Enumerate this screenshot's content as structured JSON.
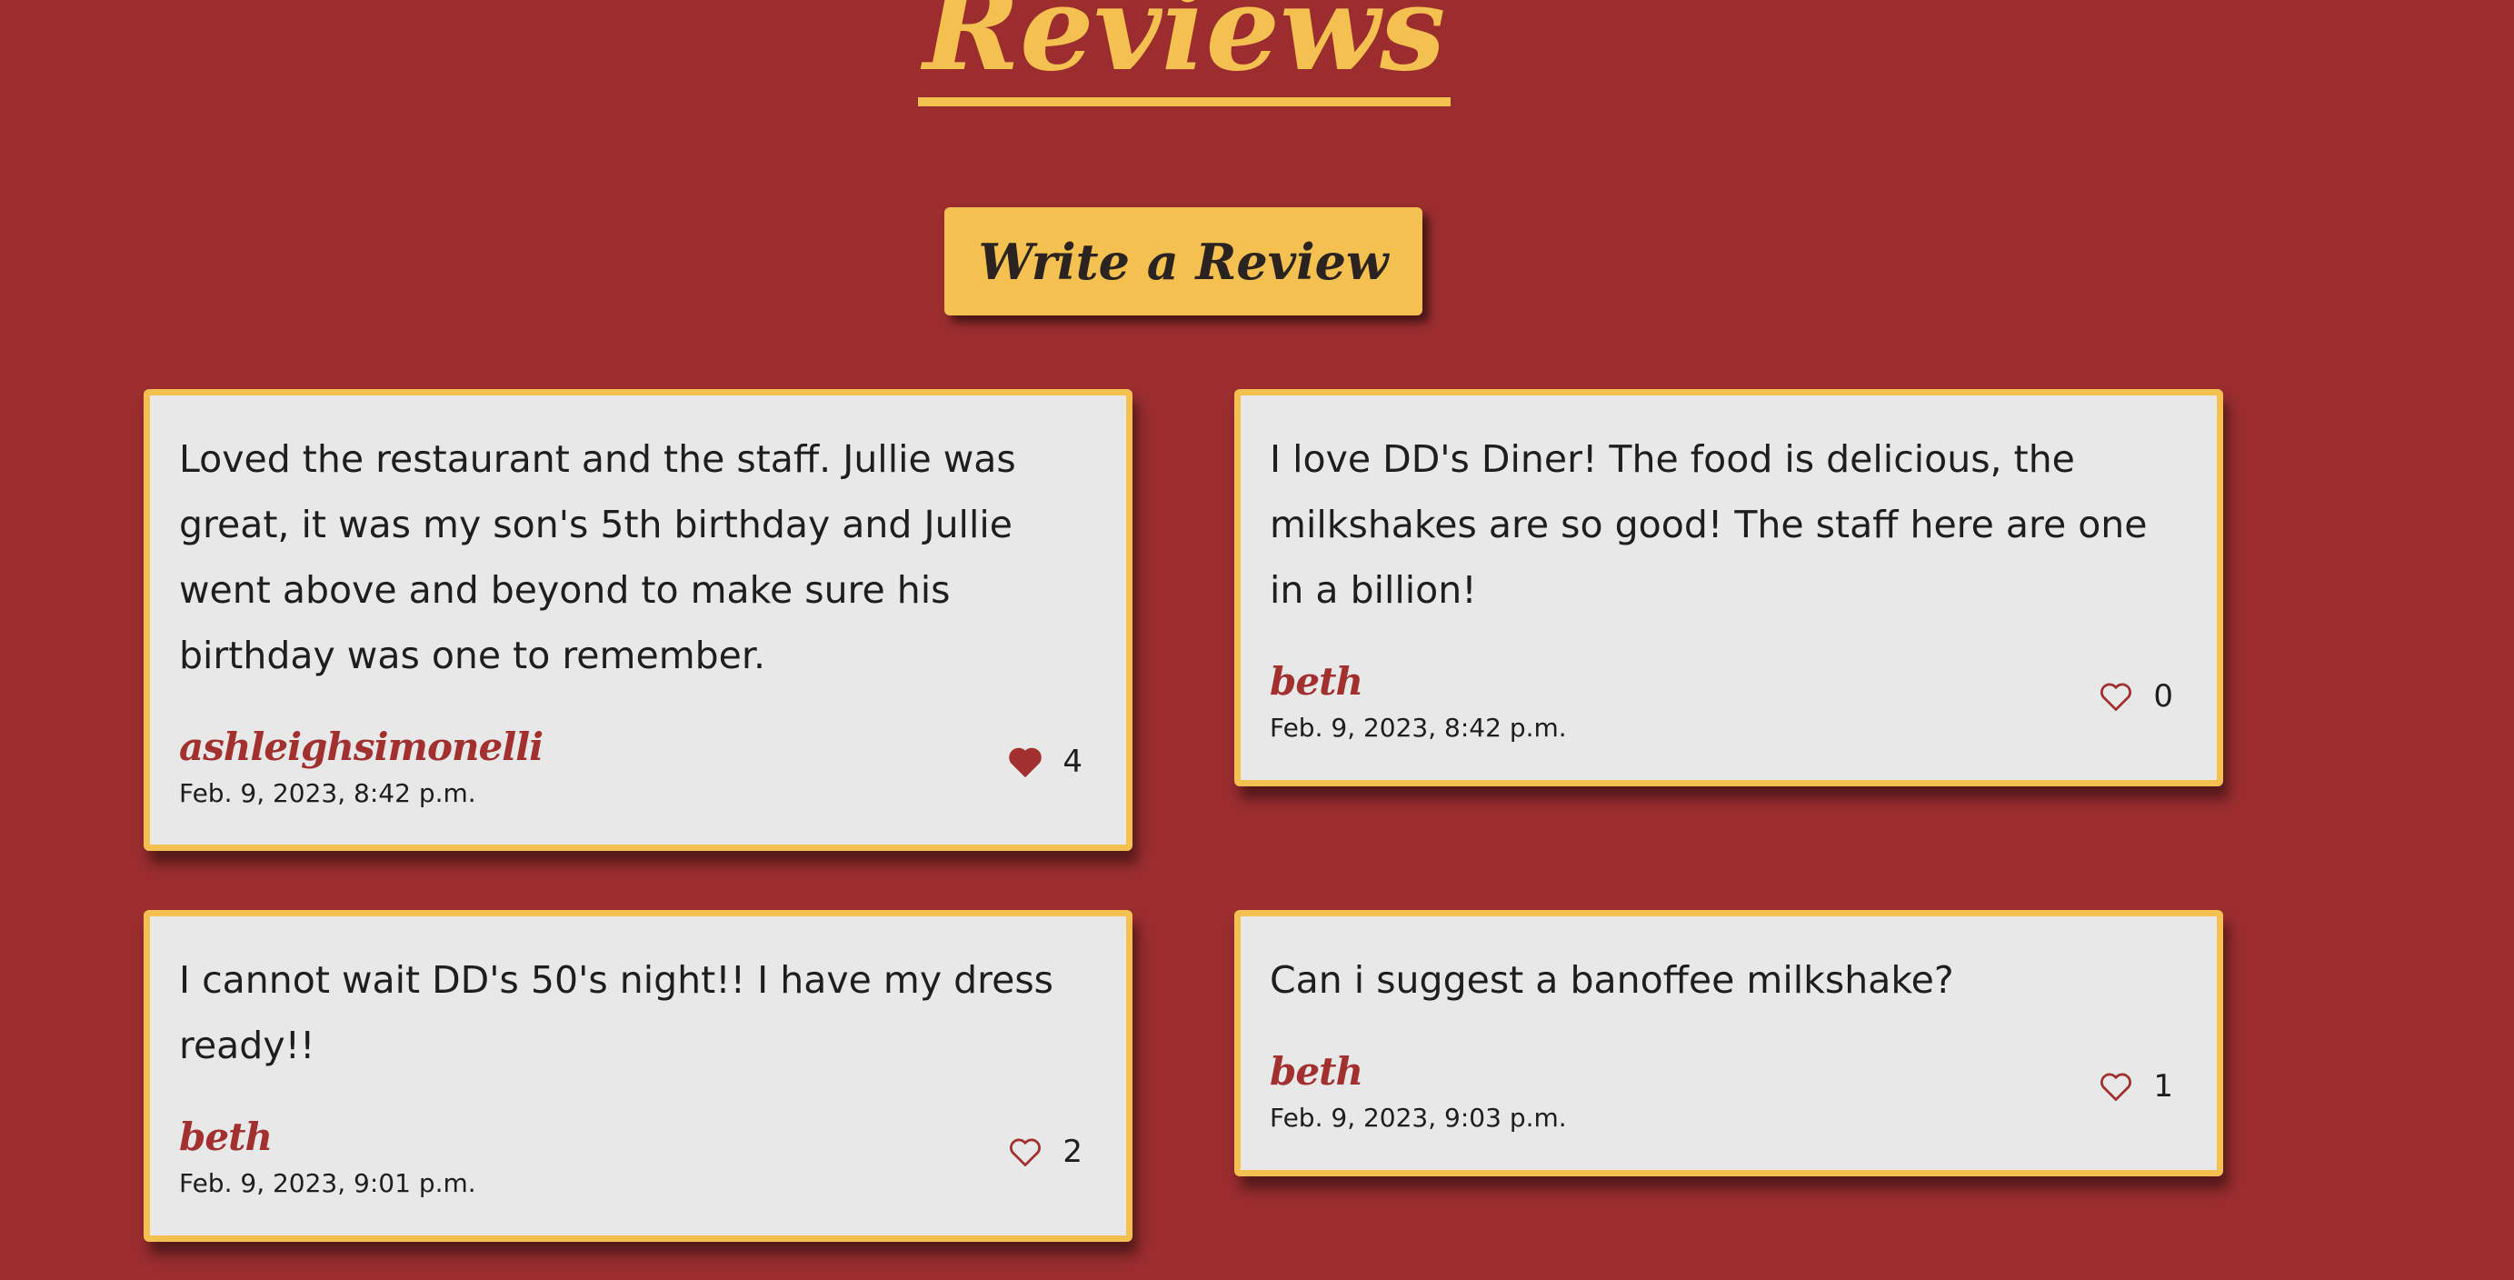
{
  "page": {
    "title": "Reviews",
    "write_review_label": "Write a Review"
  },
  "colors": {
    "background": "#9b2d2f",
    "accent": "#f4c050",
    "card": "#e8e8e8",
    "author": "#a1302f"
  },
  "reviews": [
    {
      "body": "Loved the restaurant and the staff. Jullie was great, it was my son's 5th birthday and Jullie went above and beyond to make sure his birthday was one to remember.",
      "author": "ashleighsimonelli",
      "date": "Feb. 9, 2023, 8:42 p.m.",
      "likes": "4",
      "liked": true,
      "like_icon": "heart-filled-icon"
    },
    {
      "body": "I love DD's Diner! The food is delicious, the milkshakes are so good! The staff here are one in a billion!",
      "author": "beth",
      "date": "Feb. 9, 2023, 8:42 p.m.",
      "likes": "0",
      "liked": false,
      "like_icon": "heart-outline-icon"
    },
    {
      "body": "I cannot wait DD's 50's night!! I have my dress ready!!",
      "author": "beth",
      "date": "Feb. 9, 2023, 9:01 p.m.",
      "likes": "2",
      "liked": false,
      "like_icon": "heart-outline-icon"
    },
    {
      "body": "Can i suggest a banoffee milkshake?",
      "author": "beth",
      "date": "Feb. 9, 2023, 9:03 p.m.",
      "likes": "1",
      "liked": false,
      "like_icon": "heart-outline-icon"
    }
  ]
}
